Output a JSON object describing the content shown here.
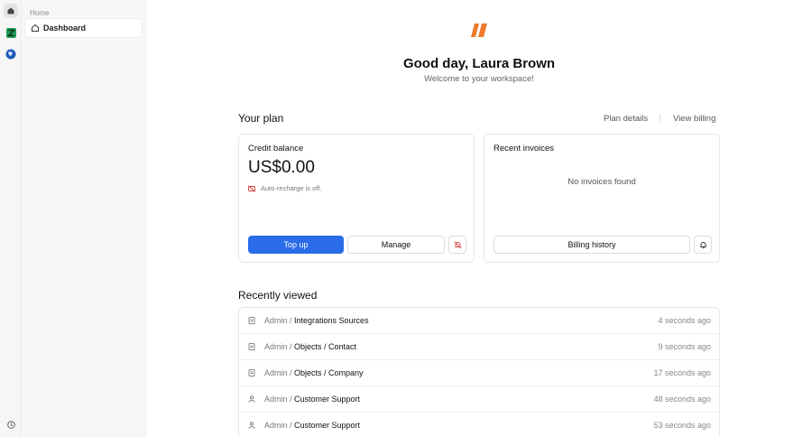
{
  "sidebar": {
    "section_label": "Home",
    "items": [
      {
        "label": "Dashboard",
        "icon": "house-icon"
      }
    ]
  },
  "rail": {
    "icons": [
      "home-icon",
      "app-icon",
      "app-icon",
      "help-icon"
    ],
    "accent_colors": [
      "#1f9d55",
      "#1e5bb8"
    ]
  },
  "header": {
    "logo": "brand-logo-icon",
    "logo_color": "#f07a2a",
    "greeting": "Good day, Laura Brown",
    "subtitle": "Welcome to your workspace!"
  },
  "plan": {
    "title": "Your plan",
    "links": {
      "plan_details": "Plan details",
      "view_billing": "View billing"
    },
    "credit": {
      "title": "Credit balance",
      "balance": "US$0.00",
      "auto_recharge": "Auto-recharge is off.",
      "top_up": "Top up",
      "manage": "Manage",
      "accent": "#2a6ce8"
    },
    "invoices": {
      "title": "Recent invoices",
      "empty": "No invoices found",
      "history": "Billing history"
    }
  },
  "recent": {
    "title": "Recently viewed",
    "items": [
      {
        "icon": "document-icon",
        "prefix": "Admin / ",
        "path": "Integrations Sources",
        "time": "4 seconds ago"
      },
      {
        "icon": "document-icon",
        "prefix": "Admin / ",
        "path": "Objects / Contact",
        "time": "9 seconds ago"
      },
      {
        "icon": "document-icon",
        "prefix": "Admin / ",
        "path": "Objects / Company",
        "time": "17 seconds ago"
      },
      {
        "icon": "person-icon",
        "prefix": "Admin / ",
        "path": "Customer Support",
        "time": "48 seconds ago"
      },
      {
        "icon": "person-icon",
        "prefix": "Admin / ",
        "path": "Customer Support",
        "time": "53 seconds ago"
      }
    ]
  }
}
